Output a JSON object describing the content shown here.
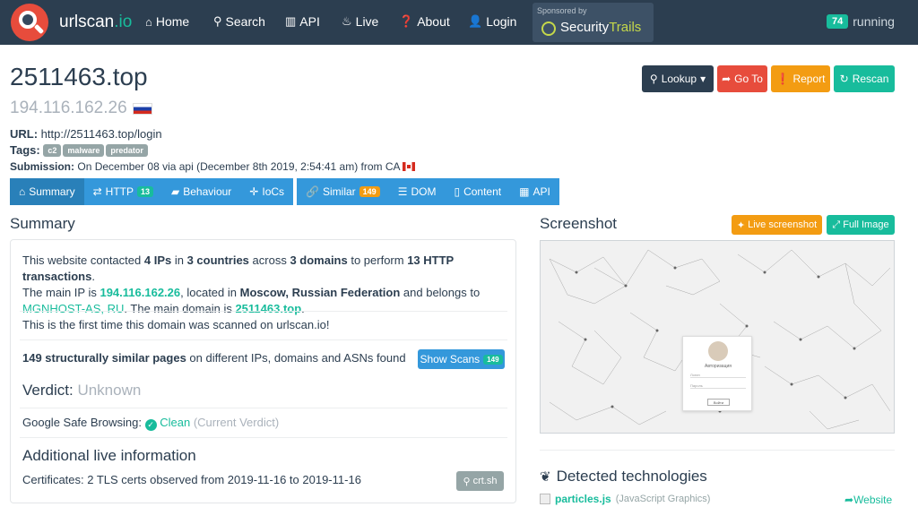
{
  "navbar": {
    "brand_main": "urlscan",
    "brand_suffix": ".io",
    "items": [
      {
        "label": "Home",
        "icon": "home-icon"
      },
      {
        "label": "Search",
        "icon": "search-icon"
      },
      {
        "label": "API",
        "icon": "barcode-icon"
      },
      {
        "label": "Live",
        "icon": "fire-icon"
      },
      {
        "label": "About",
        "icon": "question-circle-icon"
      },
      {
        "label": "Login",
        "icon": "user-icon"
      }
    ],
    "sponsor_label": "Sponsored by",
    "sponsor_name_1": "Security",
    "sponsor_name_2": "Trails",
    "running_count": "74",
    "running_label": "running"
  },
  "header": {
    "domain": "2511463.top",
    "ip": "194.116.162.26",
    "url_label": "URL:",
    "url": "http://2511463.top/login",
    "tags_label": "Tags:",
    "tags": [
      "c2",
      "malware",
      "predator"
    ],
    "submission_label": "Submission:",
    "submission_text": "On December 08 via api (December 8th 2019, 2:54:41 am) from CA"
  },
  "actions": {
    "lookup": "Lookup",
    "goto": "Go To",
    "report": "Report",
    "rescan": "Rescan"
  },
  "tabs": [
    {
      "label": "Summary",
      "icon": "home-icon"
    },
    {
      "label": "HTTP",
      "icon": "exchange-icon",
      "count": "13"
    },
    {
      "label": "Behaviour",
      "icon": "comment-icon"
    },
    {
      "label": "IoCs",
      "icon": "crosshairs-icon"
    },
    {
      "label": "Similar",
      "icon": "link-icon",
      "count": "149"
    },
    {
      "label": "DOM",
      "icon": "list-icon"
    },
    {
      "label": "Content",
      "icon": "file-icon"
    },
    {
      "label": "API",
      "icon": "grid-icon"
    }
  ],
  "summary": {
    "title": "Summary",
    "p1_a": "This website contacted ",
    "p1_ips": "4 IPs",
    "p1_b": " in ",
    "p1_countries": "3 countries",
    "p1_c": " across ",
    "p1_domains": "3 domains",
    "p1_d": " to perform ",
    "p1_http": "13 HTTP transactions",
    "p1_e": ".",
    "p2_a": "The main IP is ",
    "p2_ip": "194.116.162.26",
    "p2_b": ", located in ",
    "p2_loc": "Moscow, Russian Federation",
    "p2_c": " and belongs to",
    "p3_asn": "MGNHOST-AS, RU",
    "p3_a": ". The main domain is ",
    "p3_domain": "2511463.top",
    "p3_b": ".",
    "first_time": "This is the first time this domain was scanned on urlscan.io!",
    "similar_bold": "149 structurally similar pages",
    "similar_rest": " on different IPs, domains and ASNs found",
    "show_scans": "Show Scans",
    "show_scans_count": "149",
    "verdict_label": "Verdict:",
    "verdict_value": "Unknown",
    "gsb_label": "Google Safe Browsing:",
    "gsb_value": "Clean",
    "gsb_current": "(Current Verdict)",
    "additional_title": "Additional live information",
    "certificates": "Certificates: 2 TLS certs observed from 2019-11-16 to 2019-11-16",
    "crtsh": "crt.sh"
  },
  "screenshot": {
    "title": "Screenshot",
    "live_button": "Live screenshot",
    "full_button": "Full Image",
    "login_title": "Авторизация",
    "login_field1": "Логин",
    "login_field2": "Пароль",
    "login_button": "Войти"
  },
  "technologies": {
    "title": "Detected technologies",
    "items": [
      {
        "name": "particles.js",
        "category": "(JavaScript Graphics)",
        "link": "Website"
      }
    ]
  },
  "colors": {
    "navbar": "#2c3e50",
    "primary": "#3498db",
    "success": "#18bc9c",
    "warning": "#f39c12",
    "danger": "#e74c3c"
  }
}
